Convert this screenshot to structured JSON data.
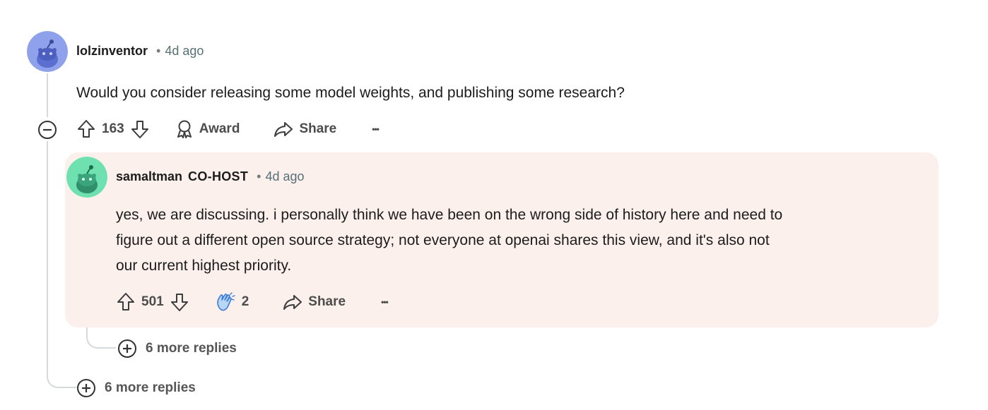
{
  "parent_comment": {
    "username": "lolzinventor",
    "separator": "•",
    "age": "4d ago",
    "text": "Would you consider releasing some model weights, and publishing some research?",
    "score": "163",
    "award_label": "Award",
    "share_label": "Share",
    "more_label": "•••"
  },
  "reply_comment": {
    "username": "samaltman",
    "flair": "CO-HOST",
    "separator": "•",
    "age": "4d ago",
    "text_line1": "yes, we are discussing. i personally think we have been on the wrong side of history here and need to",
    "text_line2": "figure out a different open source strategy; not everyone at openai shares this view, and it's also not",
    "text_line3": "our current highest priority.",
    "score": "501",
    "award_count": "2",
    "share_label": "Share",
    "more_label": "•••",
    "more_replies": "6 more replies"
  },
  "parent_more_replies": "6 more replies",
  "colors": {
    "reply_bg": "#fcf0ec",
    "parent_avatar": "#7b8fe0",
    "reply_avatar": "#4fcf9a",
    "text_muted": "#576f76"
  }
}
